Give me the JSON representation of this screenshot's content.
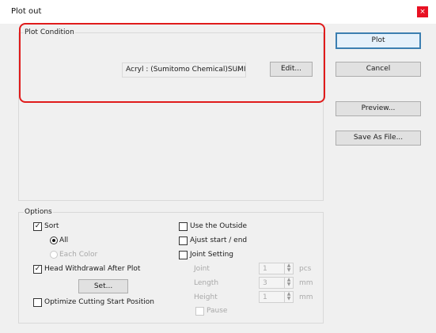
{
  "window": {
    "title": "Plot out",
    "close_glyph": "×"
  },
  "plot_condition": {
    "group_label": "Plot Condition",
    "material_value": "Acryl : (Sumitomo Chemical)SUMI",
    "edit_label": "Edit..."
  },
  "actions": {
    "plot": "Plot",
    "cancel": "Cancel",
    "preview": "Preview...",
    "save_as_file": "Save As File..."
  },
  "options": {
    "group_label": "Options",
    "sort": {
      "label": "Sort",
      "checked": true
    },
    "all": {
      "label": "All",
      "selected": true
    },
    "each_color": {
      "label": "Each Color",
      "selected": false,
      "enabled": false
    },
    "head_withdrawal": {
      "label": "Head Withdrawal After Plot",
      "checked": true
    },
    "set_label": "Set...",
    "optimize": {
      "label": "Optimize Cutting Start Position",
      "checked": false
    },
    "use_outside": {
      "label": "Use the Outside",
      "checked": false
    },
    "adjust_start_end": {
      "label": "Ajust start / end",
      "checked": false
    },
    "joint_setting": {
      "label": "Joint Setting",
      "checked": false
    },
    "joint": {
      "label": "Joint",
      "value": "1",
      "unit": "pcs"
    },
    "length": {
      "label": "Length",
      "value": "3",
      "unit": "mm"
    },
    "height": {
      "label": "Height",
      "value": "1",
      "unit": "mm"
    },
    "pause": {
      "label": "Pause",
      "checked": false
    }
  },
  "annotation": {
    "highlight_color": "#e01b1b"
  },
  "icons": {
    "checkmark": "✓",
    "chevron": "⌵",
    "spin_up": "▲",
    "spin_down": "▼"
  }
}
